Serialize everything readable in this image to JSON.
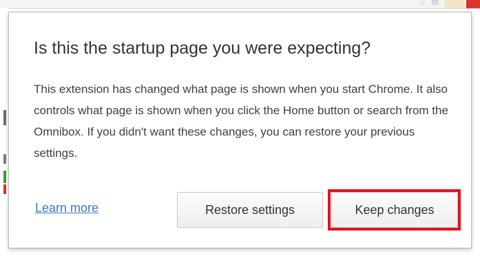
{
  "browser": {
    "toolbar_icons": "☆ ✉",
    "accent_red": "#d9352b"
  },
  "popup": {
    "title": "Is this the startup page you were expecting?",
    "body": "This extension has changed what page is shown when you start Chrome. It also controls what page is shown when you click the Home button or search from the Omnibox.  If you didn't want these changes, you can restore your previous settings.",
    "learn_more_label": "Learn more",
    "restore_button_label": "Restore settings",
    "keep_button_label": "Keep changes",
    "link_color": "#3a78cc",
    "highlight_color": "#e0141e"
  }
}
